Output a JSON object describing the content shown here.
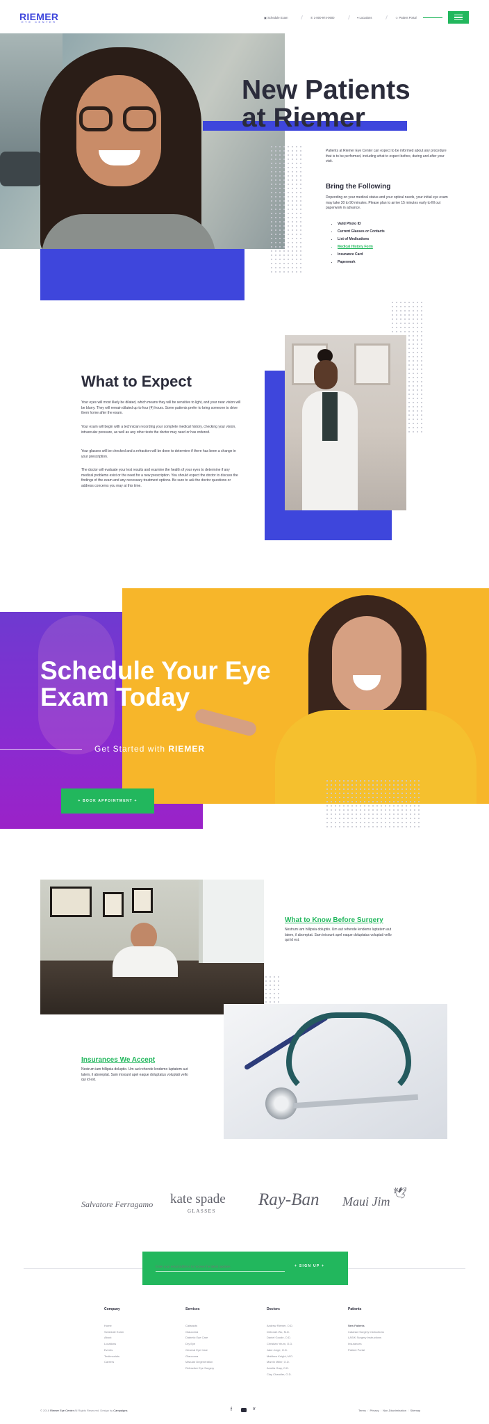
{
  "header": {
    "logo": "RIEMER",
    "logo_sub": "EYE CENTER",
    "nav": [
      "Schedule Exam",
      "1-800-974-0600",
      "Locations",
      "Patient Portal"
    ]
  },
  "hero": {
    "title_line1": "New Patients",
    "title_line2": "at Riemer",
    "intro": "Patients at Riemer Eye Center can expect to be informed about any procedure that is to be performed, including what to expect before, during and after your visit.",
    "bring_title": "Bring the Following",
    "bring_text": "Depending on your medical status and your optical needs, your initial eye exam may take 30 to 90 minutes. Please plan to arrive 15 minutes early to fill out paperwork in advance.",
    "items": [
      "Valid Photo ID",
      "Current Glasses or Contacts",
      "List of Medications",
      "Medical History Form",
      "Insurance Card",
      "Paperwork"
    ]
  },
  "expect": {
    "title": "What to Expect",
    "p1": "Your eyes will most likely be dilated, which means they will be sensitive to light, and your near vision will be blurry. They will remain dilated up to four (4) hours. Some patients prefer to bring someone to drive them home after the exam.",
    "p2": "Your exam will begin with a technician recording your complete medical history, checking your vision, intraocular pressure, as well as any other tests the doctor may need or has ordered.",
    "p3": "Your glasses will be checked and a refraction will be done to determine if there has been a change in your prescription.",
    "p4": "The doctor will evaluate your test results and examine the health of your eyes to determine if any medical problems exist or the need for a new prescription. You should expect the doctor to discuss the findings of the exam and any necessary treatment options. Be sure to ask the doctor questions or address concerns you may at this time."
  },
  "schedule": {
    "title_line1": "Schedule Your Eye",
    "title_line2": "Exam Today",
    "subtitle": "Get Started with",
    "subtitle_brand": "RIEMER",
    "button": "+ BOOK APPOINTMENT +"
  },
  "surgery": {
    "title": "What to Know Before Surgery",
    "text": "Nestrum iam hillipsia doluptio. Um aut rehende lendemo luptatem aut latem, il aboreptat. Sam inisount apel eaque doluptatus voluptati vello qui id est."
  },
  "insurance": {
    "title": "Insurances We Accept",
    "text": "Nestrum iam hillipsia doluptio. Um aut rehende lendemo luptatem aut latem, il aboreptat. Sam inisount apel eaque doluptatus voluptati vello qui id est."
  },
  "brands": [
    "Salvatore Ferragamo",
    "kate spade",
    "GLASSES",
    "Ray-Ban",
    "Maui Jim"
  ],
  "newsletter": {
    "placeholder": "Enter your email address to receive the latest updates",
    "button": "+ SIGN UP +"
  },
  "footer": {
    "columns": [
      {
        "title": "Company",
        "links": [
          "Home",
          "Schedule Exam",
          "About",
          "Locations",
          "Events",
          "Testimonials",
          "Careers"
        ]
      },
      {
        "title": "Services",
        "links": [
          "Cataracts",
          "Glaucoma",
          "Diabetic Eye Care",
          "Dry Eye",
          "General Eye Care",
          "Glaucoma",
          "Macular Degeneration",
          "Refractive Eye Surgery"
        ]
      },
      {
        "title": "Doctors",
        "links": [
          "Andrew Riemer, O.D.",
          "Deborah Wu, M.D.",
          "Daniel Goode, O.D.",
          "Christian Yeum, O.D.",
          "Jake Jorge, O.D.",
          "Matthew Knight, M.D.",
          "Marvin Miller, O.D.",
          "Amelia Gray, O.D.",
          "Clay Chandler, O.D."
        ]
      },
      {
        "title": "Patients",
        "links": [
          "New Patients",
          "Cataract Surgery Instructions",
          "LASIK Surgery Instructions",
          "Insurances",
          "Patient Portal"
        ]
      }
    ],
    "copyright_prefix": "© 2018",
    "copyright_brand": "Riemer Eye Center",
    "copyright_mid": "All Rights Reserved. Design by",
    "copyright_design": "Campaigns",
    "legal": [
      "Terms",
      "Privacy",
      "Non-Discrimination",
      "Sitemap"
    ]
  }
}
